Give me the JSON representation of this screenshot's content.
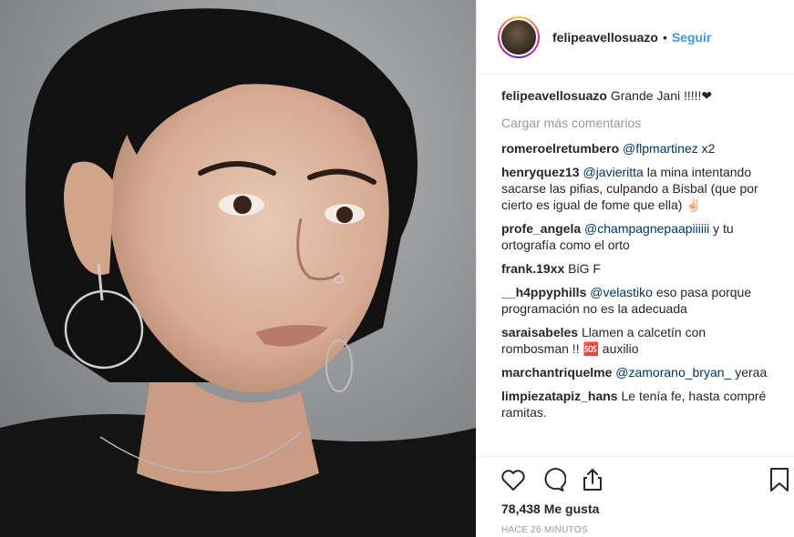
{
  "header": {
    "username": "felipeavellosuazo",
    "separator": "•",
    "follow_label": "Seguir"
  },
  "caption": {
    "username": "felipeavellosuazo",
    "text": " Grande Jani !!!!!❤"
  },
  "load_more_label": "Cargar más comentarios",
  "comments": [
    {
      "user": "romeroelretumbero",
      "mention": "@flpmartinez",
      "text": " x2"
    },
    {
      "user": "henryquez13",
      "mention": "@javieritta",
      "text": " la mina intentando sacarse las pifias, culpando a Bisbal (que por cierto es igual de fome que ella) ✌🏻"
    },
    {
      "user": "profe_angela",
      "mention": "@champagnepaapiiiiii",
      "text": " y tu ortografía como el orto"
    },
    {
      "user": "frank.19xx",
      "mention": "",
      "text": " BiG F"
    },
    {
      "user": "__h4ppyphills",
      "mention": "@velastiko",
      "text": " eso pasa porque programación no es la adecuada"
    },
    {
      "user": "saraisabeles",
      "mention": "",
      "text": " Llamen a calcetín con rombosman !! 🆘 auxilio"
    },
    {
      "user": "marchantriquelme",
      "mention": "@zamorano_bryan_",
      "text": " yeraa"
    },
    {
      "user": "limpiezatapiz_hans",
      "mention": "",
      "text": " Le tenía fe, hasta compré ramitas."
    }
  ],
  "actions": {
    "like_icon": "heart-icon",
    "comment_icon": "comment-icon",
    "share_icon": "share-icon",
    "save_icon": "bookmark-icon"
  },
  "likes_label": "78,438 Me gusta",
  "timestamp": "Hace 26 minutos",
  "colors": {
    "link": "#3897f0",
    "mention": "#003569",
    "muted": "#999999",
    "border": "#efefef"
  }
}
